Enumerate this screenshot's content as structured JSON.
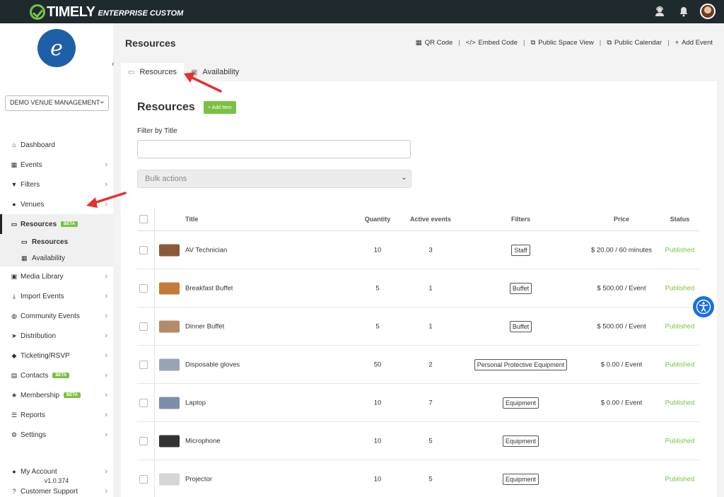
{
  "app": {
    "logo_text": "TIMELY",
    "logo_sub": "ENTERPRISE CUSTOM"
  },
  "sidebar": {
    "venue": "DEMO VENUE MANAGEMENT",
    "items": [
      {
        "label": "Dashboard",
        "icon": "home-icon"
      },
      {
        "label": "Events",
        "icon": "calendar-icon"
      },
      {
        "label": "Filters",
        "icon": "filter-icon"
      },
      {
        "label": "Venues",
        "icon": "map-pin-icon"
      },
      {
        "label": "Resources",
        "badge": "BETA",
        "icon": "monitor-icon"
      },
      {
        "label": "Media Library",
        "icon": "image-icon"
      },
      {
        "label": "Import Events",
        "icon": "download-icon"
      },
      {
        "label": "Community Events",
        "icon": "globe-icon"
      },
      {
        "label": "Distribution",
        "icon": "send-icon"
      },
      {
        "label": "Ticketing/RSVP",
        "icon": "ticket-icon"
      },
      {
        "label": "Contacts",
        "badge": "BETA",
        "icon": "contact-card-icon"
      },
      {
        "label": "Membership",
        "badge": "BETA",
        "icon": "star-icon"
      },
      {
        "label": "Reports",
        "icon": "list-icon"
      },
      {
        "label": "Settings",
        "icon": "gears-icon"
      }
    ],
    "sub_items": [
      "Resources",
      "Availability"
    ],
    "footer_items": [
      "My Account",
      "Customer Support"
    ],
    "version": "v1.0.374"
  },
  "header": {
    "title": "Resources",
    "actions": [
      "QR Code",
      "Embed Code",
      "Public Space View",
      "Public Calendar",
      "Add Event"
    ]
  },
  "tabs": [
    "Resources",
    "Availability"
  ],
  "panel": {
    "title": "Resources",
    "add_label": "+ Add Item",
    "filter_label": "Filter by Title",
    "bulk_label": "Bulk actions"
  },
  "table": {
    "headers": [
      "Title",
      "Quantity",
      "Active events",
      "Filters",
      "Price",
      "Status"
    ],
    "rows": [
      {
        "title": "AV Technician",
        "quantity": "10",
        "active": "3",
        "filter": "Staff",
        "price": "$ 20.00 / 60 minutes",
        "status": "Published",
        "thumb": "#8a5a3a"
      },
      {
        "title": "Breakfast Buffet",
        "quantity": "5",
        "active": "1",
        "filter": "Buffet",
        "price": "$ 500.00 / Event",
        "status": "Published",
        "thumb": "#c47a3a"
      },
      {
        "title": "Dinner Buffet",
        "quantity": "5",
        "active": "1",
        "filter": "Buffet",
        "price": "$ 500.00 / Event",
        "status": "Published",
        "thumb": "#b58a6a"
      },
      {
        "title": "Disposable gloves",
        "quantity": "50",
        "active": "2",
        "filter": "Personal Protective Equipment",
        "price": "$ 0.00 / Event",
        "status": "Published",
        "thumb": "#9aa4b4"
      },
      {
        "title": "Laptop",
        "quantity": "10",
        "active": "7",
        "filter": "Equipment",
        "price": "$ 0.00 / Event",
        "status": "Published",
        "thumb": "#7d8fa8"
      },
      {
        "title": "Microphone",
        "quantity": "10",
        "active": "5",
        "filter": "Equipment",
        "price": "",
        "status": "Published",
        "thumb": "#333333"
      },
      {
        "title": "Projector",
        "quantity": "10",
        "active": "5",
        "filter": "Equipment",
        "price": "",
        "status": "Published",
        "thumb": "#d6d6d6"
      }
    ]
  },
  "colors": {
    "accent": "#7ac143",
    "topbar": "#1f2a2f",
    "annotation_arrow": "#e53030",
    "accessibility": "#1a6fe0"
  }
}
